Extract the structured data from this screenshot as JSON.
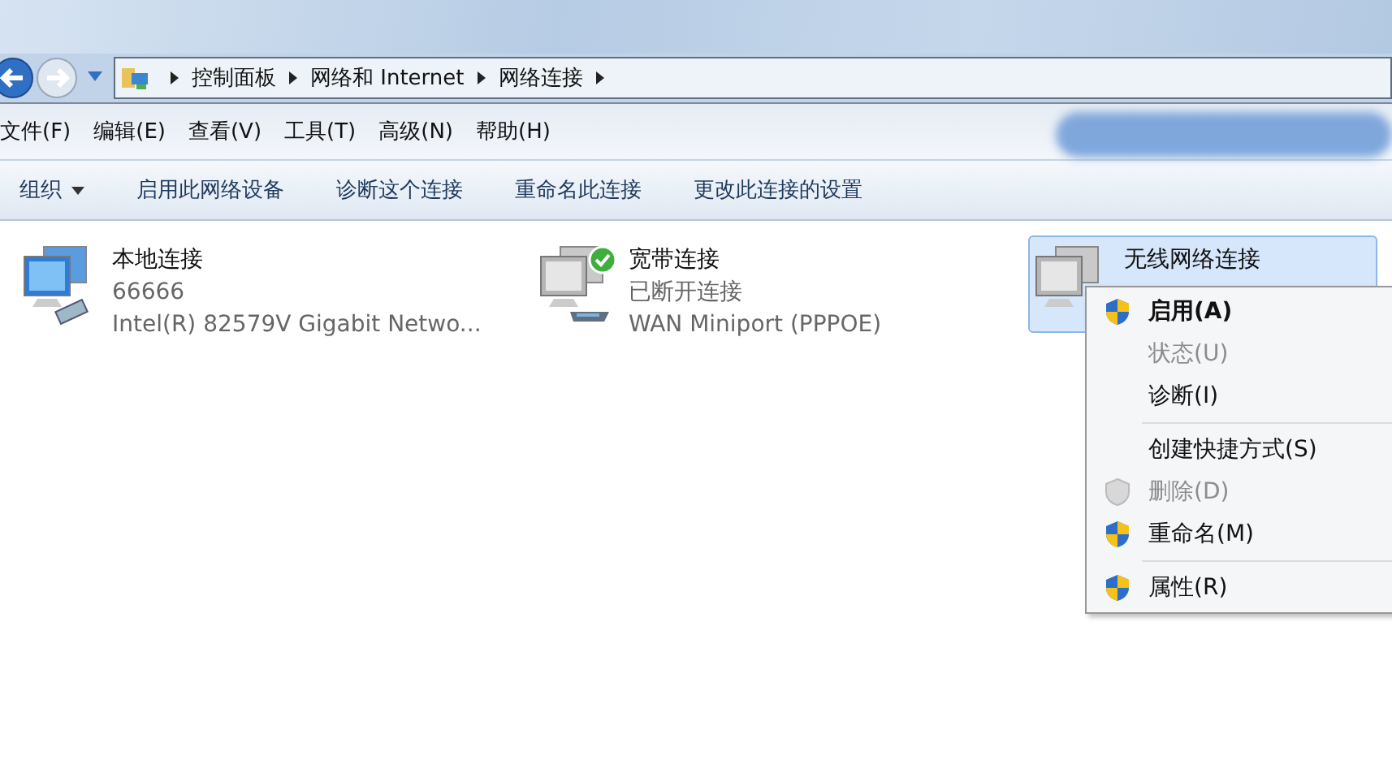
{
  "address_bar": {
    "crumbs": [
      "控制面板",
      "网络和 Internet",
      "网络连接"
    ]
  },
  "menu_bar": [
    "文件(F)",
    "编辑(E)",
    "查看(V)",
    "工具(T)",
    "高级(N)",
    "帮助(H)"
  ],
  "toolbar": [
    {
      "label": "组织",
      "dropdown": true
    },
    {
      "label": "启用此网络设备",
      "dropdown": false
    },
    {
      "label": "诊断这个连接",
      "dropdown": false
    },
    {
      "label": "重命名此连接",
      "dropdown": false
    },
    {
      "label": "更改此连接的设置",
      "dropdown": false
    }
  ],
  "connections": [
    {
      "name": "本地连接",
      "status": "66666",
      "device": "Intel(R) 82579V Gigabit Netwo...",
      "kind": "ethernet",
      "connected": false,
      "selected": false
    },
    {
      "name": "宽带连接",
      "status": "已断开连接",
      "device": "WAN Miniport (PPPOE)",
      "kind": "broadband",
      "connected": true,
      "selected": false
    },
    {
      "name": "无线网络连接",
      "kind": "wireless",
      "connected": false,
      "selected": true
    }
  ],
  "context_menu": [
    {
      "kind": "item",
      "label": "启用(A)",
      "bold": true,
      "disabled": false,
      "shield": true
    },
    {
      "kind": "item",
      "label": "状态(U)",
      "bold": false,
      "disabled": true,
      "shield": false
    },
    {
      "kind": "item",
      "label": "诊断(I)",
      "bold": false,
      "disabled": false,
      "shield": false
    },
    {
      "kind": "separator"
    },
    {
      "kind": "item",
      "label": "创建快捷方式(S)",
      "bold": false,
      "disabled": false,
      "shield": false
    },
    {
      "kind": "item",
      "label": "删除(D)",
      "bold": false,
      "disabled": true,
      "shield": true
    },
    {
      "kind": "item",
      "label": "重命名(M)",
      "bold": false,
      "disabled": false,
      "shield": true
    },
    {
      "kind": "separator"
    },
    {
      "kind": "item",
      "label": "属性(R)",
      "bold": false,
      "disabled": false,
      "shield": true
    }
  ]
}
